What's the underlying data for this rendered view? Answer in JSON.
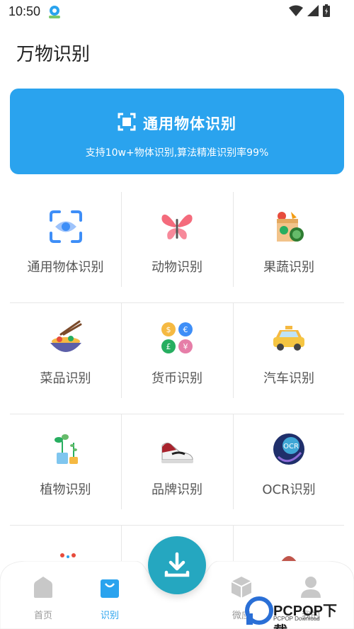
{
  "status_bar": {
    "time": "10:50"
  },
  "page": {
    "title": "万物识别"
  },
  "hero": {
    "title": "通用物体识别",
    "subtitle": "支持10w+物体识别,算法精准识别率99%",
    "color": "#2aa3ee"
  },
  "grid": {
    "rows": [
      [
        {
          "label": "通用物体识别",
          "icon": "eye-scan-icon"
        },
        {
          "label": "动物识别",
          "icon": "butterfly-icon"
        },
        {
          "label": "果蔬识别",
          "icon": "grocery-bag-icon"
        }
      ],
      [
        {
          "label": "菜品识别",
          "icon": "noodle-bowl-icon"
        },
        {
          "label": "货币识别",
          "icon": "coins-icon"
        },
        {
          "label": "汽车识别",
          "icon": "taxi-icon"
        }
      ],
      [
        {
          "label": "植物识别",
          "icon": "potted-plant-icon"
        },
        {
          "label": "品牌识别",
          "icon": "sneaker-icon"
        },
        {
          "label": "OCR识别",
          "icon": "ocr-icon"
        }
      ]
    ]
  },
  "tabbar": {
    "tabs": [
      {
        "label": "首页",
        "icon": "home-icon",
        "active": false
      },
      {
        "label": "识别",
        "icon": "shopping-bag-icon",
        "active": true
      },
      {
        "label": "微应",
        "icon": "cube-icon",
        "active": false
      },
      {
        "label": "我的",
        "icon": "person-icon",
        "active": false
      }
    ],
    "fab_icon": "download-icon"
  },
  "watermark": {
    "text": "PCPOP下载",
    "sub": "PCPOP Download"
  }
}
